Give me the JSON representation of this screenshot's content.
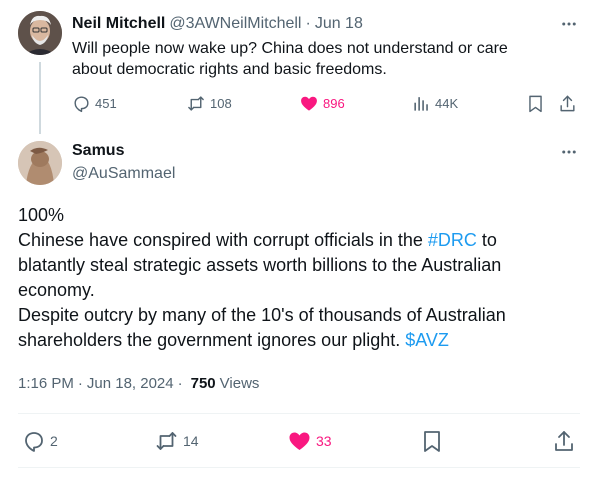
{
  "colors": {
    "text": "#0f1419",
    "secondary": "#536471",
    "link": "#1d9bf0",
    "like": "#f91880",
    "divider": "#eff3f4"
  },
  "parent_tweet": {
    "author_name": "Neil Mitchell",
    "author_handle": "@3AWNeilMitchell",
    "separator": "·",
    "date": "Jun 18",
    "text_line1": "Will people now wake up? China does not understand or care",
    "text_line2": "about democratic rights and basic freedoms.",
    "actions": {
      "replies": "451",
      "reposts": "108",
      "likes": "896",
      "views": "44K"
    },
    "icons": [
      "more-icon",
      "reply-icon",
      "repost-icon",
      "like-icon-filled",
      "analytics-icon",
      "bookmark-icon",
      "share-icon"
    ]
  },
  "main_tweet": {
    "author_name": "Samus",
    "author_handle": "@AuSammael",
    "text": {
      "line1": "100%",
      "line2_pre": "Chinese have conspired with corrupt officials in the ",
      "hashtag": "#DRC",
      "line2_post": " to",
      "line3": "blatantly steal strategic assets worth billions to the Australian",
      "line4": "economy.",
      "line5": "Despite outcry by many of the 10's of thousands of Australian",
      "line6_pre": "shareholders the government ignores our plight. ",
      "cashtag": "$AVZ"
    },
    "meta": {
      "time": "1:16 PM",
      "separator": "·",
      "date": "Jun 18, 2024",
      "separator2": "·",
      "views_count": "750",
      "views_label": "Views"
    },
    "actions": {
      "replies": "2",
      "reposts": "14",
      "likes": "33"
    },
    "icons": [
      "more-icon",
      "reply-icon",
      "repost-icon",
      "like-icon-filled",
      "bookmark-icon",
      "share-icon"
    ]
  }
}
